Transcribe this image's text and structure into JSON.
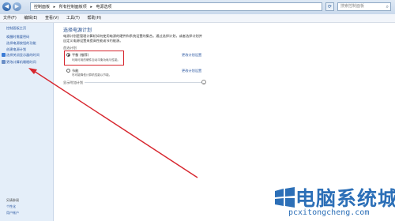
{
  "address_bar": {
    "crumbs": [
      "控制面板",
      "▸",
      "所有控制面板项",
      "▸",
      "电源选项"
    ]
  },
  "search": {
    "placeholder": "搜索控制面板"
  },
  "menu": [
    "文件(F)",
    "编辑(E)",
    "查看(V)",
    "工具(T)",
    "帮助(H)"
  ],
  "sidebar": {
    "items": [
      {
        "label": "控制面板主页"
      },
      {
        "label": "唤醒时需要密码"
      },
      {
        "label": "选择电源按钮的功能"
      },
      {
        "label": "创建电源计划"
      },
      {
        "label": "选择关闭显示器的时间"
      },
      {
        "label": "更改计算机睡眠时间"
      }
    ],
    "see_also": {
      "heading": "另请参阅",
      "items": [
        "个性化",
        "用户帐户"
      ]
    }
  },
  "main": {
    "title": "选择电源计划",
    "description": "电源计划是管理计算机如何使用电源的硬件和系统设置的集合。通过选择计划，或者选择计划并自定义电源设置来提高性能或节约能源。",
    "section_label": "首选计划",
    "plans": [
      {
        "name": "平衡 (推荐)",
        "desc": "利用可用的硬件自动平衡功耗与性能。",
        "selected": true,
        "change_link": "更改计划设置"
      },
      {
        "name": "节能",
        "desc": "尽可能降低计算机性能以节能。",
        "selected": false,
        "change_link": "更改计划设置"
      }
    ],
    "additional_plans": "显示附加计划"
  },
  "watermark": {
    "text": "电脑系统城",
    "url": "pcxitongcheng.com"
  },
  "colors": {
    "highlight": "#d7262e",
    "link": "#2a56a0",
    "sidebar_bg": "#e4eef9",
    "watermark": "#2c6fb7"
  }
}
